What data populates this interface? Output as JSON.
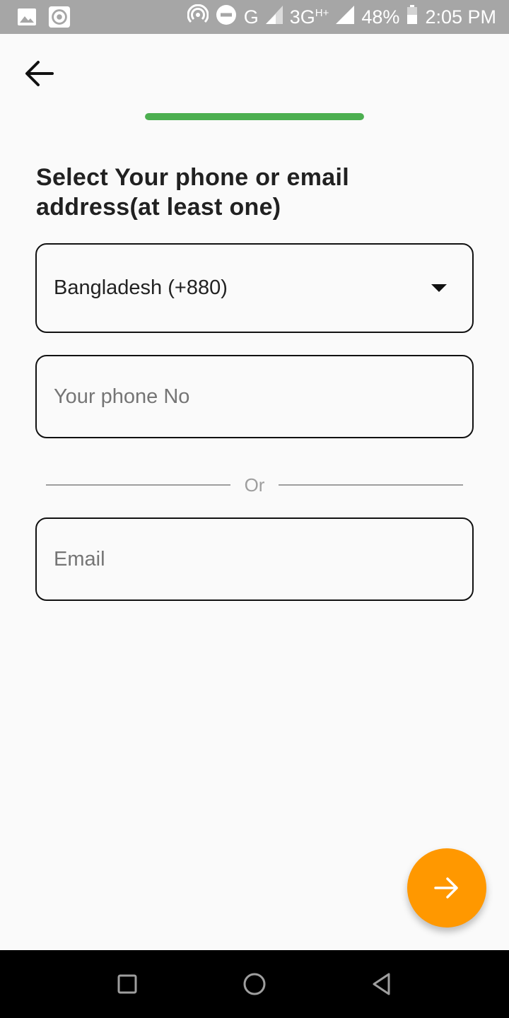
{
  "status_bar": {
    "network_g": "G",
    "network_3g": "3G",
    "network_plus": "H+",
    "battery": "48%",
    "time": "2:05 PM",
    "icons": [
      "image-icon",
      "record-icon",
      "hotspot-icon",
      "dnd-icon",
      "signal-icon",
      "battery-icon"
    ]
  },
  "header": {
    "back_icon": "arrow-left-icon",
    "progress": 1.0,
    "progress_color": "#4caf50"
  },
  "form": {
    "title": "Select Your phone or email address(at least one)",
    "country_value": "Bangladesh (+880)",
    "phone_placeholder": "Your phone No",
    "divider_text": "Or",
    "email_placeholder": "Email"
  },
  "fab": {
    "icon": "arrow-right-icon",
    "color": "#ff9800"
  },
  "nav_bar": {
    "icons": [
      "recent-apps-icon",
      "home-icon",
      "back-icon"
    ]
  }
}
